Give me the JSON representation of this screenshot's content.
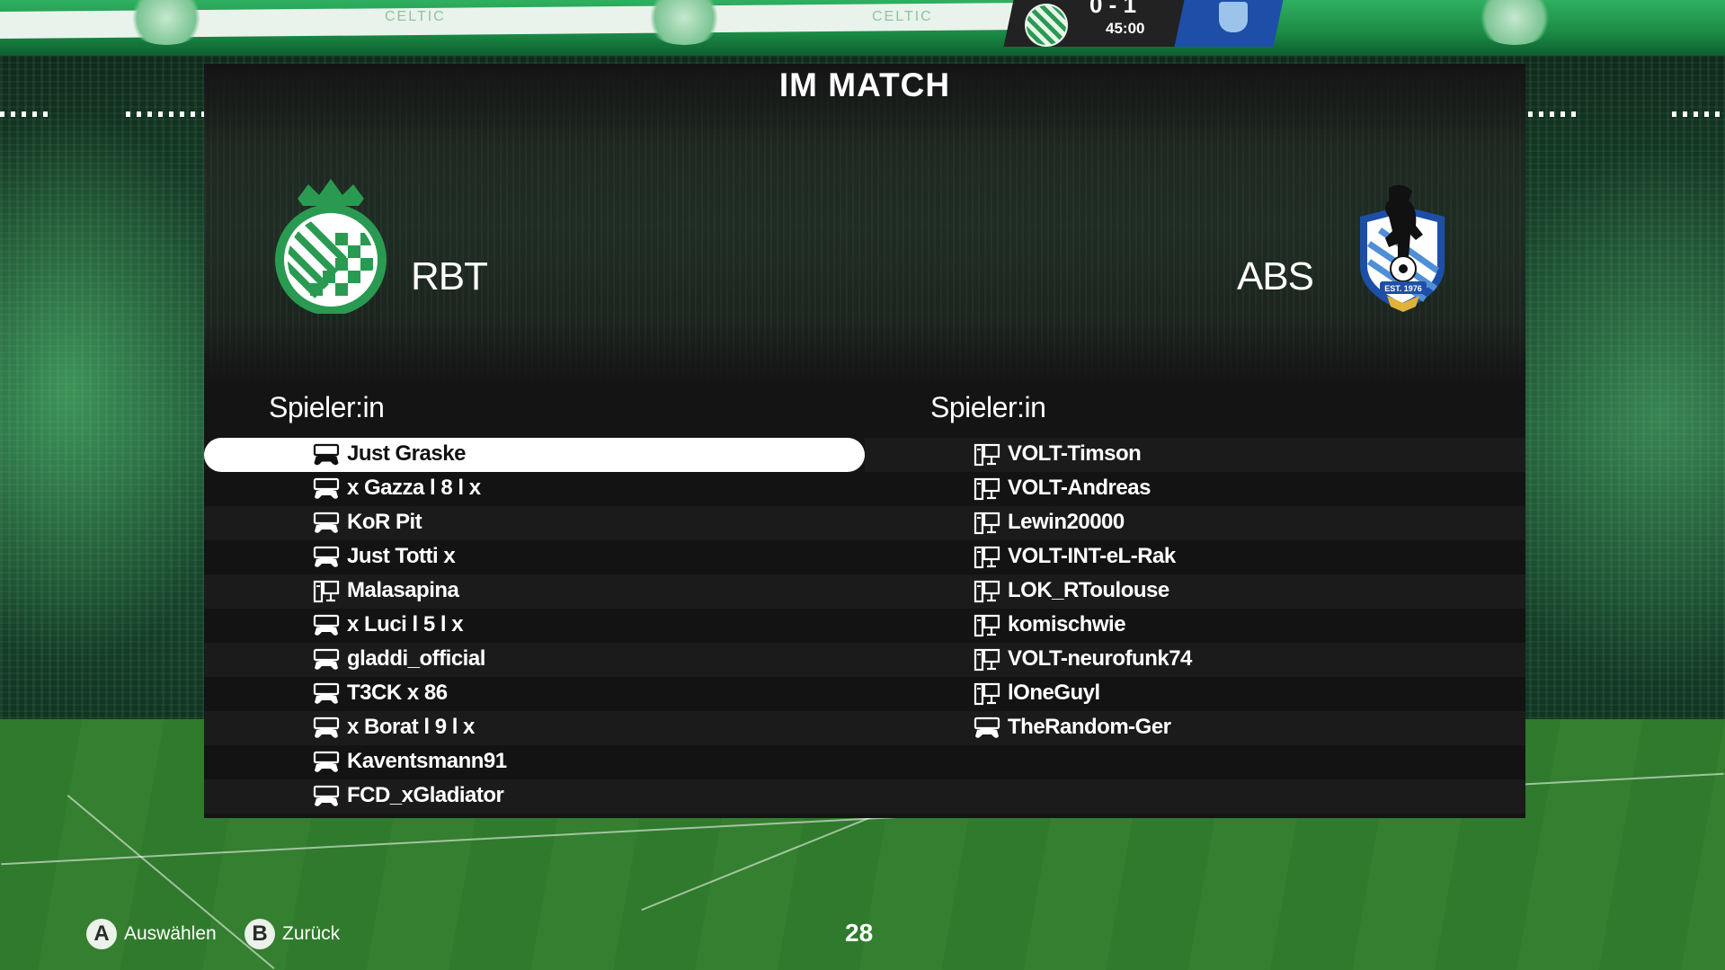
{
  "screen_title": "IM MATCH",
  "scoreboard": {
    "score": "0 - 1",
    "time": "45:00"
  },
  "roof_text": [
    "CELTIC",
    "CELTIC"
  ],
  "home_team": {
    "name": "RBT",
    "crest_icon": "green-checkered-crest-icon",
    "color": "#2a9a52"
  },
  "away_team": {
    "name": "ABS",
    "crest_icon": "bear-shield-crest-icon",
    "crest_text": "EST. 1976",
    "color": "#1d4fa8"
  },
  "home_players": {
    "header": "Spieler:in",
    "items": [
      {
        "name": "Just Graske",
        "platform": "controller-icon",
        "selected": true
      },
      {
        "name": "x Gazza l 8 l x",
        "platform": "controller-icon"
      },
      {
        "name": "KoR Pit",
        "platform": "controller-icon"
      },
      {
        "name": "Just Totti x",
        "platform": "controller-icon"
      },
      {
        "name": "Malasapina",
        "platform": "pc-icon"
      },
      {
        "name": "x Luci l 5 l x",
        "platform": "controller-icon"
      },
      {
        "name": "gladdi_official",
        "platform": "controller-icon"
      },
      {
        "name": "T3CK x 86",
        "platform": "controller-icon"
      },
      {
        "name": "x Borat l 9 l x",
        "platform": "controller-icon"
      },
      {
        "name": "Kaventsmann91",
        "platform": "controller-icon"
      },
      {
        "name": "FCD_xGladiator",
        "platform": "controller-icon"
      }
    ]
  },
  "away_players": {
    "header": "Spieler:in",
    "items": [
      {
        "name": "VOLT-Timson",
        "platform": "pc-icon"
      },
      {
        "name": "VOLT-Andreas",
        "platform": "pc-icon"
      },
      {
        "name": "Lewin20000",
        "platform": "pc-icon"
      },
      {
        "name": "VOLT-INT-eL-Rak",
        "platform": "pc-icon"
      },
      {
        "name": "LOK_RToulouse",
        "platform": "pc-icon"
      },
      {
        "name": "komischwie",
        "platform": "pc-icon"
      },
      {
        "name": "VOLT-neurofunk74",
        "platform": "pc-icon"
      },
      {
        "name": "lOneGuyl",
        "platform": "pc-icon"
      },
      {
        "name": "TheRandom-Ger",
        "platform": "controller-icon"
      }
    ]
  },
  "footer": {
    "select": {
      "button": "A",
      "label": "Auswählen"
    },
    "back": {
      "button": "B",
      "label": "Zurück"
    },
    "page_number": "28"
  }
}
